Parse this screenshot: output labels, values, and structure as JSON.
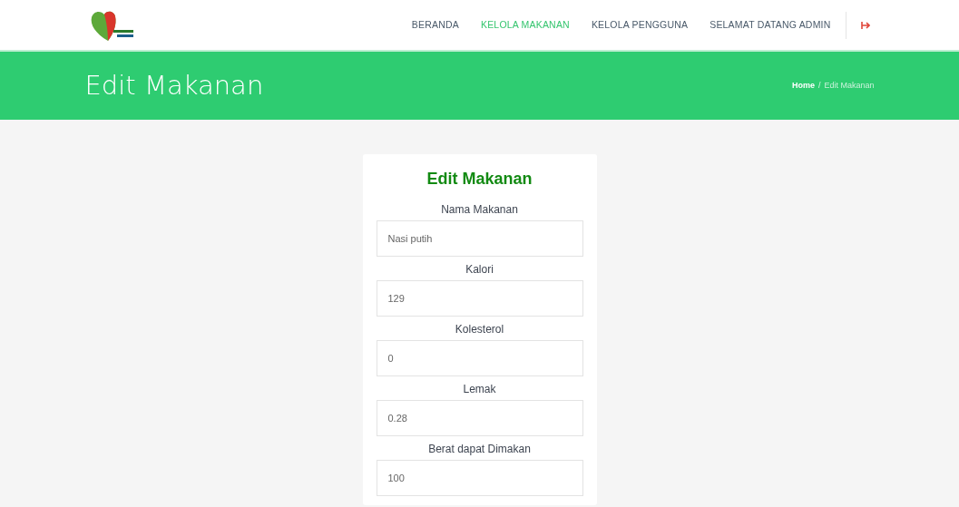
{
  "nav": {
    "items": [
      {
        "label": "BERANDA",
        "selected": false
      },
      {
        "label": "KELOLA MAKANAN",
        "selected": true
      },
      {
        "label": "KELOLA PENGGUNA",
        "selected": false
      },
      {
        "label": "SELAMAT DATANG ADMIN",
        "selected": false
      }
    ]
  },
  "header": {
    "title": "Edit Makanan",
    "breadcrumb": [
      "Home",
      "Edit Makanan"
    ],
    "breadcrumb_separator": "/"
  },
  "form": {
    "title": "Edit Makanan",
    "fields": [
      {
        "label": "Nama Makanan",
        "value": "Nasi putih"
      },
      {
        "label": "Kalori",
        "value": "129"
      },
      {
        "label": "Kolesterol",
        "value": "0"
      },
      {
        "label": "Lemak",
        "value": "0.28"
      },
      {
        "label": "Berat dapat Dimakan",
        "value": "100"
      }
    ]
  }
}
